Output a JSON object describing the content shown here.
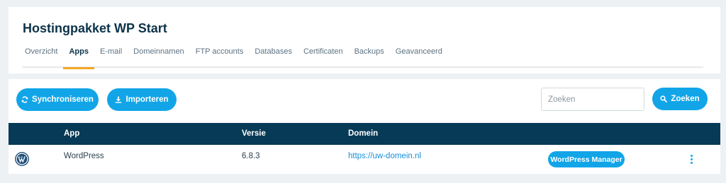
{
  "page": {
    "title": "Hostingpakket WP Start"
  },
  "tabs": [
    {
      "label": "Overzicht"
    },
    {
      "label": "Apps"
    },
    {
      "label": "E-mail"
    },
    {
      "label": "Domeinnamen"
    },
    {
      "label": "FTP accounts"
    },
    {
      "label": "Databases"
    },
    {
      "label": "Certificaten"
    },
    {
      "label": "Backups"
    },
    {
      "label": "Geavanceerd"
    }
  ],
  "active_tab": "Apps",
  "toolbar": {
    "sync_label": "Synchroniseren",
    "import_label": "Importeren",
    "search_placeholder": "Zoeken",
    "search_value": "",
    "search_button_label": "Zoeken"
  },
  "table": {
    "headers": {
      "app": "App",
      "version": "Versie",
      "domain": "Domein"
    },
    "rows": [
      {
        "icon": "wordpress-icon",
        "app": "WordPress",
        "version": "6.8.3",
        "domain": "https://uw-domein.nl",
        "action_label": "WordPress Manager",
        "menu_icon": "kebab-menu-icon"
      }
    ]
  },
  "colors": {
    "accent": "#11a5e8",
    "header_bg": "#073a56",
    "active_tab_underline": "#f5a623",
    "title": "#0d3349",
    "page_bg": "#eef1f4"
  }
}
